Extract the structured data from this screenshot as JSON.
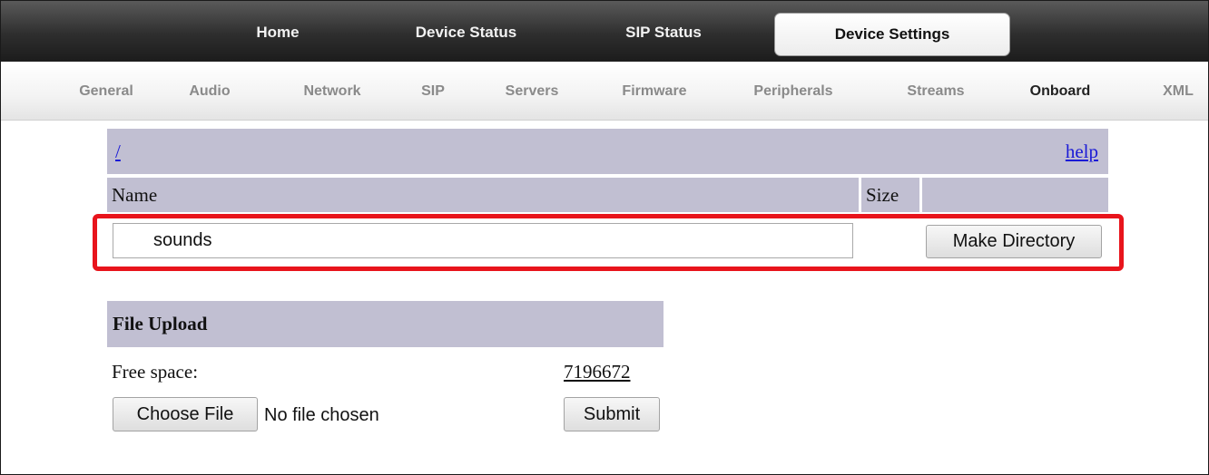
{
  "top_nav": {
    "tabs": [
      {
        "label": "Home"
      },
      {
        "label": "Device Status"
      },
      {
        "label": "SIP Status"
      },
      {
        "label": "Device Settings"
      }
    ]
  },
  "sub_nav": {
    "items": [
      {
        "label": "General"
      },
      {
        "label": "Audio"
      },
      {
        "label": "Network"
      },
      {
        "label": "SIP"
      },
      {
        "label": "Servers"
      },
      {
        "label": "Firmware"
      },
      {
        "label": "Peripherals"
      },
      {
        "label": "Streams"
      },
      {
        "label": "Onboard"
      },
      {
        "label": "XML"
      }
    ],
    "active": "Onboard"
  },
  "file_browser": {
    "path_link": "/",
    "help_link": "help",
    "columns": [
      "Name",
      "Size"
    ],
    "new_directory_value": "sounds",
    "make_directory_label": "Make Directory"
  },
  "file_upload": {
    "title": "File Upload",
    "free_space_label": "Free space:",
    "free_space_value": "7196672",
    "choose_file_label": "Choose File",
    "no_file_text": "No file chosen",
    "submit_label": "Submit"
  },
  "colors": {
    "highlight": "#e8141c",
    "header_bg": "#c1bfd2",
    "link": "#1a1ad6"
  }
}
